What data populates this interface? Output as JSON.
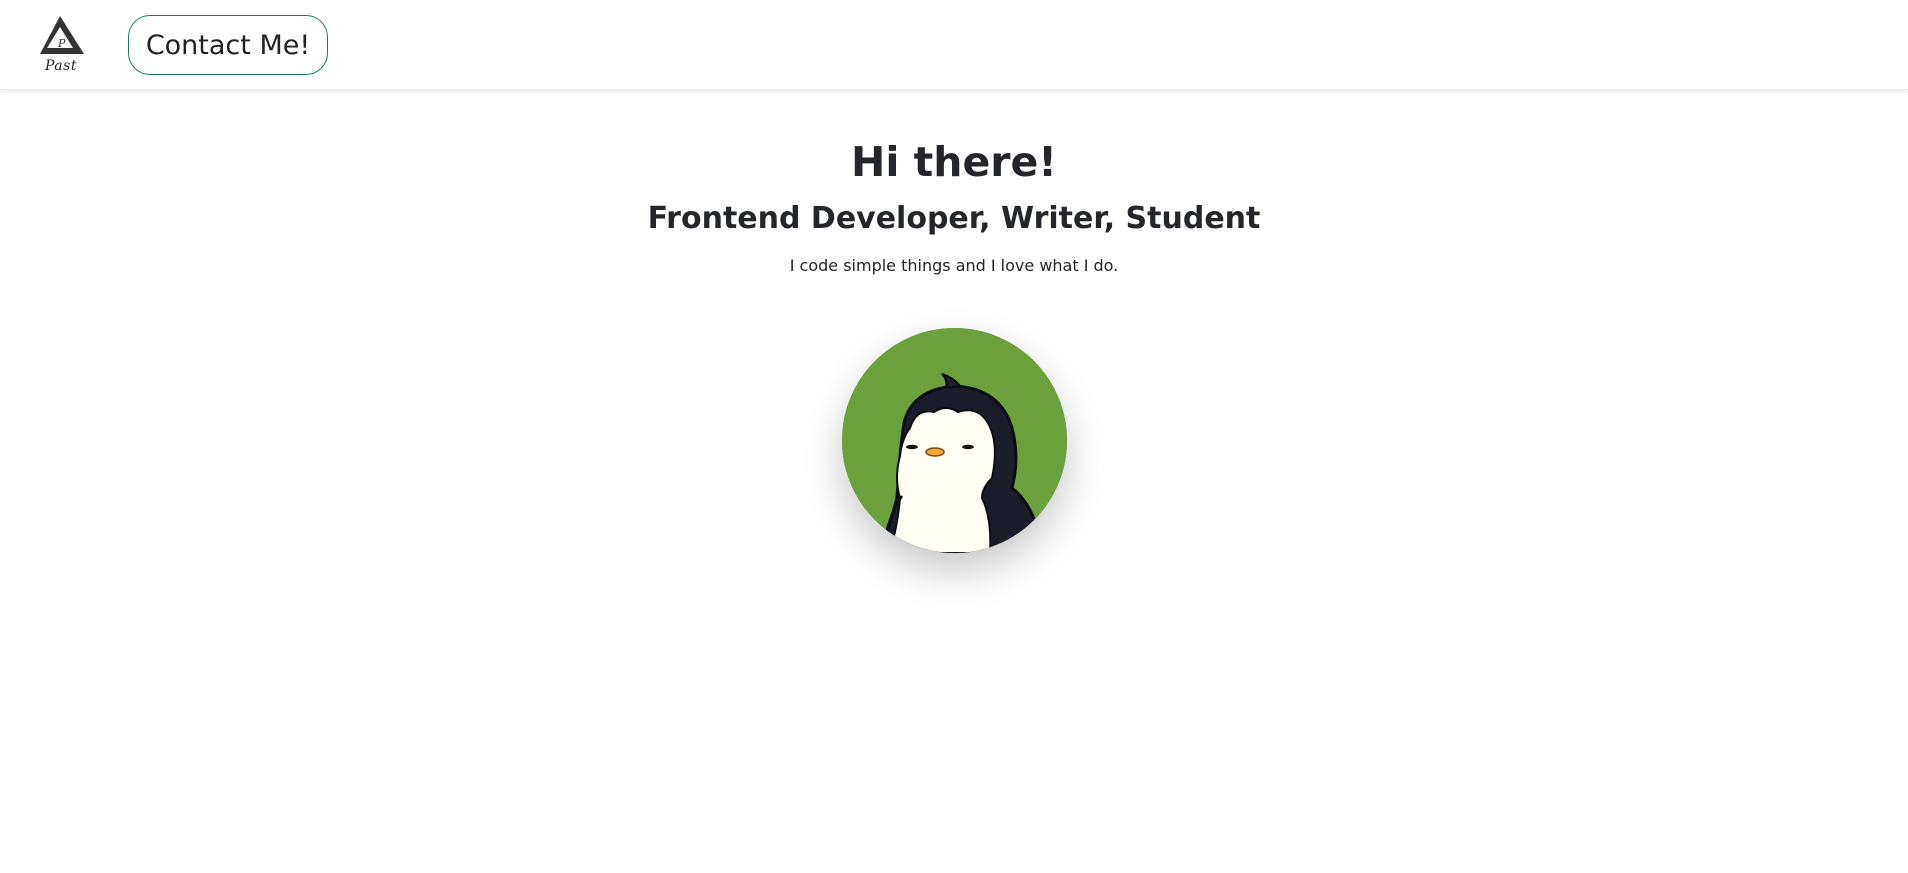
{
  "header": {
    "logo_text": "Past",
    "contact_label": "Contact Me!"
  },
  "hero": {
    "title": "Hi there!",
    "subtitle": "Frontend Developer, Writer, Student",
    "text": "I code simple things and I love what I do."
  },
  "avatar": {
    "icon": "penguin-avatar",
    "background": "#6ba13d"
  },
  "colors": {
    "accent_border": "#1d7a62",
    "text": "#24262b"
  }
}
